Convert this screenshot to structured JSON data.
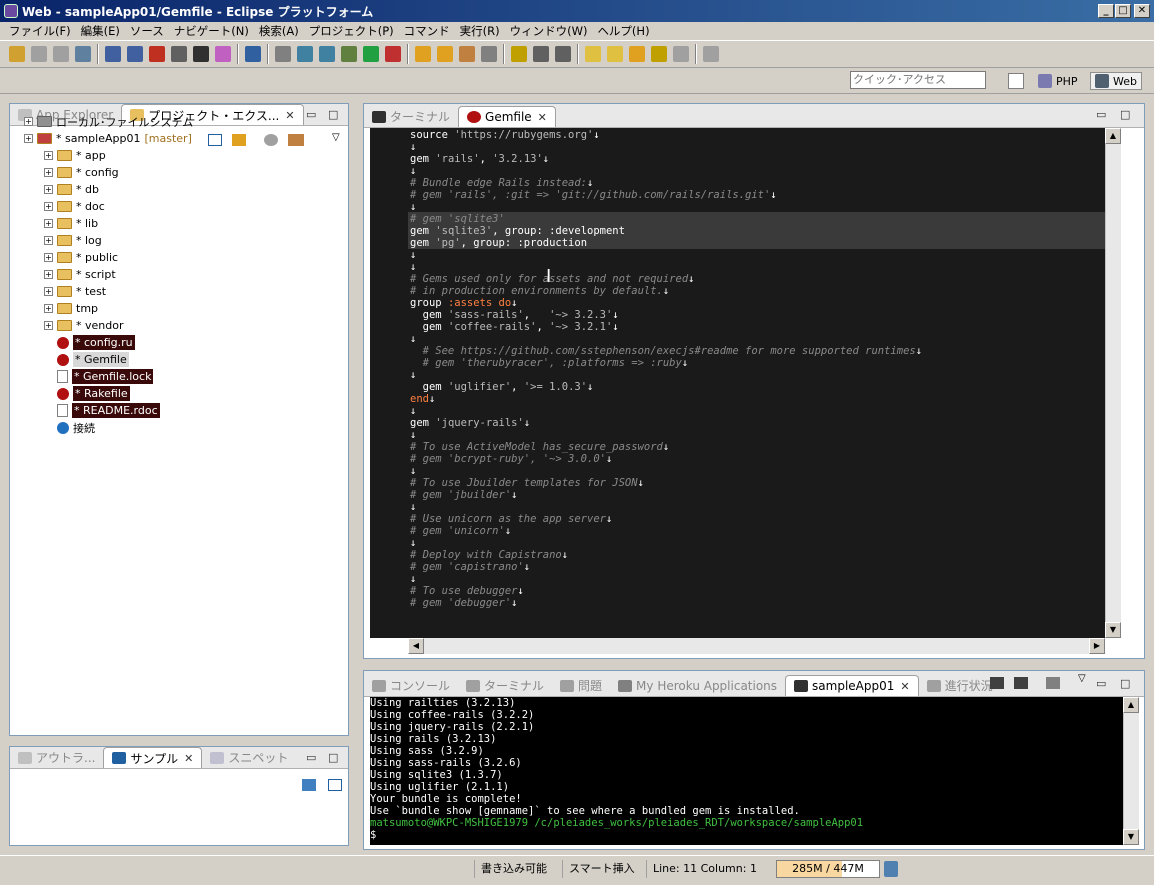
{
  "window": {
    "title": "Web - sampleApp01/Gemfile - Eclipse プラットフォーム"
  },
  "menu": [
    "ファイル(F)",
    "編集(E)",
    "ソース",
    "ナビゲート(N)",
    "検索(A)",
    "プロジェクト(P)",
    "コマンド",
    "実行(R)",
    "ウィンドウ(W)",
    "ヘルプ(H)"
  ],
  "quick_access": {
    "placeholder": "クイック･アクセス"
  },
  "perspectives": [
    "PHP",
    "Web"
  ],
  "left_panel": {
    "tabs": [
      "App Explorer",
      "プロジェクト・エクス..."
    ],
    "tree": [
      {
        "label": "ローカル･ファイルシステム",
        "type": "drive",
        "level": 0
      },
      {
        "label": "* sampleApp01",
        "branch": "[master]",
        "type": "project",
        "level": 0
      },
      {
        "label": "* app",
        "type": "folder",
        "level": 1
      },
      {
        "label": "* config",
        "type": "folder",
        "level": 1
      },
      {
        "label": "* db",
        "type": "folder",
        "level": 1
      },
      {
        "label": "* doc",
        "type": "folder",
        "level": 1
      },
      {
        "label": "* lib",
        "type": "folder",
        "level": 1
      },
      {
        "label": "* log",
        "type": "folder",
        "level": 1
      },
      {
        "label": "* public",
        "type": "folder",
        "level": 1
      },
      {
        "label": "* script",
        "type": "folder",
        "level": 1
      },
      {
        "label": "* test",
        "type": "folder",
        "level": 1
      },
      {
        "label": "tmp",
        "type": "folder",
        "level": 1
      },
      {
        "label": "* vendor",
        "type": "folder",
        "level": 1
      },
      {
        "label": "* config.ru",
        "type": "ruby",
        "level": 1
      },
      {
        "label": "* Gemfile",
        "type": "ruby",
        "level": 1
      },
      {
        "label": "* Gemfile.lock",
        "type": "file",
        "level": 1
      },
      {
        "label": "* Rakefile",
        "type": "ruby",
        "level": 1
      },
      {
        "label": "* README.rdoc",
        "type": "file",
        "level": 1
      },
      {
        "label": "接続",
        "type": "globe",
        "level": 1
      }
    ]
  },
  "bottom_left_panel": {
    "tabs": [
      "アウトラ...",
      "サンプル",
      "スニペット"
    ]
  },
  "editor": {
    "tabs": [
      "ターミナル",
      "Gemfile"
    ],
    "lines": [
      [
        {
          "t": "source ",
          "c": "n"
        },
        {
          "t": "'https://rubygems.org'",
          "c": "s"
        },
        {
          "t": "↓",
          "c": "n"
        }
      ],
      [
        {
          "t": "↓",
          "c": "n"
        }
      ],
      [
        {
          "t": "gem ",
          "c": "n"
        },
        {
          "t": "'rails'",
          "c": "s"
        },
        {
          "t": ", ",
          "c": "n"
        },
        {
          "t": "'3.2.13'",
          "c": "s"
        },
        {
          "t": "↓",
          "c": "n"
        }
      ],
      [
        {
          "t": "↓",
          "c": "n"
        }
      ],
      [
        {
          "t": "# Bundle edge Rails instead:",
          "c": "m"
        },
        {
          "t": "↓",
          "c": "n"
        }
      ],
      [
        {
          "t": "# gem 'rails', :git => 'git://github.com/rails/rails.git'",
          "c": "m"
        },
        {
          "t": "↓",
          "c": "n"
        }
      ],
      [
        {
          "t": "↓",
          "c": "n"
        }
      ],
      [
        {
          "t": "# gem 'sqlite3'",
          "c": "m"
        }
      ],
      [
        {
          "t": "gem ",
          "c": "n"
        },
        {
          "t": "'sqlite3'",
          "c": "s"
        },
        {
          "t": ", group: :development",
          "c": "n"
        }
      ],
      [
        {
          "t": "gem ",
          "c": "n"
        },
        {
          "t": "'pg'",
          "c": "s"
        },
        {
          "t": ", group: :production",
          "c": "n"
        }
      ],
      [
        {
          "t": "↓",
          "c": "n"
        }
      ],
      [
        {
          "t": "↓",
          "c": "n"
        }
      ],
      [
        {
          "t": "# Gems used only for assets and not required",
          "c": "m"
        },
        {
          "t": "↓",
          "c": "n"
        }
      ],
      [
        {
          "t": "# in production environments by default.",
          "c": "m"
        },
        {
          "t": "↓",
          "c": "n"
        }
      ],
      [
        {
          "t": "group ",
          "c": "n"
        },
        {
          "t": ":assets",
          "c": "k"
        },
        {
          "t": " do",
          "c": "k"
        },
        {
          "t": "↓",
          "c": "n"
        }
      ],
      [
        {
          "t": "  gem ",
          "c": "n"
        },
        {
          "t": "'sass-rails'",
          "c": "s"
        },
        {
          "t": ",   ",
          "c": "n"
        },
        {
          "t": "'~> 3.2.3'",
          "c": "s"
        },
        {
          "t": "↓",
          "c": "n"
        }
      ],
      [
        {
          "t": "  gem ",
          "c": "n"
        },
        {
          "t": "'coffee-rails'",
          "c": "s"
        },
        {
          "t": ", ",
          "c": "n"
        },
        {
          "t": "'~> 3.2.1'",
          "c": "s"
        },
        {
          "t": "↓",
          "c": "n"
        }
      ],
      [
        {
          "t": "↓",
          "c": "n"
        }
      ],
      [
        {
          "t": "  # See https://github.com/sstephenson/execjs#readme for more supported runtimes",
          "c": "m"
        },
        {
          "t": "↓",
          "c": "n"
        }
      ],
      [
        {
          "t": "  # gem 'therubyracer', :platforms => :ruby",
          "c": "m"
        },
        {
          "t": "↓",
          "c": "n"
        }
      ],
      [
        {
          "t": "↓",
          "c": "n"
        }
      ],
      [
        {
          "t": "  gem ",
          "c": "n"
        },
        {
          "t": "'uglifier'",
          "c": "s"
        },
        {
          "t": ", ",
          "c": "n"
        },
        {
          "t": "'>= 1.0.3'",
          "c": "s"
        },
        {
          "t": "↓",
          "c": "n"
        }
      ],
      [
        {
          "t": "end",
          "c": "k"
        },
        {
          "t": "↓",
          "c": "n"
        }
      ],
      [
        {
          "t": "↓",
          "c": "n"
        }
      ],
      [
        {
          "t": "gem ",
          "c": "n"
        },
        {
          "t": "'jquery-rails'",
          "c": "s"
        },
        {
          "t": "↓",
          "c": "n"
        }
      ],
      [
        {
          "t": "↓",
          "c": "n"
        }
      ],
      [
        {
          "t": "# To use ActiveModel has_secure_password",
          "c": "m"
        },
        {
          "t": "↓",
          "c": "n"
        }
      ],
      [
        {
          "t": "# gem 'bcrypt-ruby', '~> 3.0.0'",
          "c": "m"
        },
        {
          "t": "↓",
          "c": "n"
        }
      ],
      [
        {
          "t": "↓",
          "c": "n"
        }
      ],
      [
        {
          "t": "# To use Jbuilder templates for JSON",
          "c": "m"
        },
        {
          "t": "↓",
          "c": "n"
        }
      ],
      [
        {
          "t": "# gem 'jbuilder'",
          "c": "m"
        },
        {
          "t": "↓",
          "c": "n"
        }
      ],
      [
        {
          "t": "↓",
          "c": "n"
        }
      ],
      [
        {
          "t": "# Use unicorn as the app server",
          "c": "m"
        },
        {
          "t": "↓",
          "c": "n"
        }
      ],
      [
        {
          "t": "# gem 'unicorn'",
          "c": "m"
        },
        {
          "t": "↓",
          "c": "n"
        }
      ],
      [
        {
          "t": "↓",
          "c": "n"
        }
      ],
      [
        {
          "t": "# Deploy with Capistrano",
          "c": "m"
        },
        {
          "t": "↓",
          "c": "n"
        }
      ],
      [
        {
          "t": "# gem 'capistrano'",
          "c": "m"
        },
        {
          "t": "↓",
          "c": "n"
        }
      ],
      [
        {
          "t": "↓",
          "c": "n"
        }
      ],
      [
        {
          "t": "# To use debugger",
          "c": "m"
        },
        {
          "t": "↓",
          "c": "n"
        }
      ],
      [
        {
          "t": "# gem 'debugger'",
          "c": "m"
        },
        {
          "t": "↓",
          "c": "n"
        }
      ],
      [
        {
          "t": "",
          "c": "n"
        }
      ]
    ]
  },
  "bottom_panel": {
    "tabs": [
      "コンソール",
      "ターミナル",
      "問題",
      "My Heroku Applications",
      "sampleApp01",
      "進行状況"
    ],
    "console_lines": [
      {
        "t": "Using railties (3.2.13)",
        "c": "#ffffff"
      },
      {
        "t": "Using coffee-rails (3.2.2)",
        "c": "#ffffff"
      },
      {
        "t": "Using jquery-rails (2.2.1)",
        "c": "#ffffff"
      },
      {
        "t": "Using rails (3.2.13)",
        "c": "#ffffff"
      },
      {
        "t": "Using sass (3.2.9)",
        "c": "#ffffff"
      },
      {
        "t": "Using sass-rails (3.2.6)",
        "c": "#ffffff"
      },
      {
        "t": "Using sqlite3 (1.3.7)",
        "c": "#ffffff"
      },
      {
        "t": "Using uglifier (2.1.1)",
        "c": "#ffffff"
      },
      {
        "t": "Your bundle is complete!",
        "c": "#ffffff"
      },
      {
        "t": "Use `bundle show [gemname]` to see where a bundled gem is installed.",
        "c": "#ffffff"
      },
      {
        "t": "matsumoto@WKPC-MSHIGE1979 /c/pleiades_works/pleiades_RDT/workspace/sampleApp01",
        "c": "#40c040"
      },
      {
        "t": "$",
        "c": "#ffffff"
      }
    ]
  },
  "status": {
    "writable": "書き込み可能",
    "insert_mode": "スマート挿入",
    "position": "Line: 11 Column: 1",
    "heap_used": "285M",
    "heap_total": "447M",
    "heap_fraction": 0.64
  }
}
